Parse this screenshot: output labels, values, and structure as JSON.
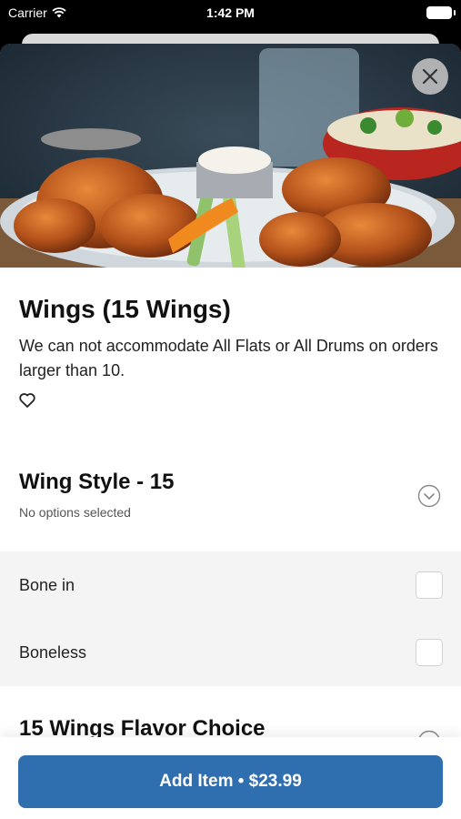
{
  "status_bar": {
    "carrier": "Carrier",
    "time": "1:42 PM"
  },
  "item": {
    "title": "Wings (15 Wings)",
    "description": "We can not accommodate All Flats or All Drums on orders larger than 10."
  },
  "sections": [
    {
      "title": "Wing Style - 15",
      "subtitle": "No options selected",
      "options": [
        {
          "label": "Bone in",
          "checked": false
        },
        {
          "label": "Boneless",
          "checked": false
        }
      ]
    },
    {
      "title": "15 Wings Flavor Choice"
    }
  ],
  "footer": {
    "add_label": "Add Item • $23.99"
  },
  "colors": {
    "accent": "#2f6fb0"
  },
  "icons": [
    "wifi-icon",
    "battery-icon",
    "close-icon",
    "heart-icon",
    "chevron-down-circle-icon",
    "checkbox-icon"
  ]
}
